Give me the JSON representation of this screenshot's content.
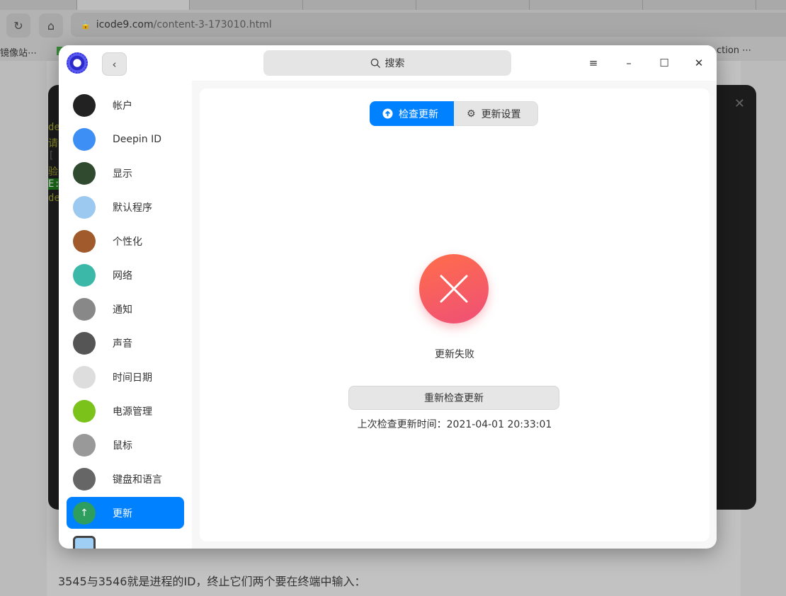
{
  "browser": {
    "url_host": "icode9.com",
    "url_path": "/content-3-173010.html",
    "bookmark_left": "镜像站⋯",
    "bookmark_right": "ction ⋯"
  },
  "article": {
    "text": "3545与3546就是进程的ID，终止它们两个要在终端中输入："
  },
  "terminal": {
    "lines": [
      "de",
      "请",
      "[ S",
      "验",
      "E:",
      "de"
    ]
  },
  "window": {
    "search_placeholder": "搜索",
    "sidebar": [
      {
        "label": "帐户",
        "icon": "account-icon",
        "color": "#222"
      },
      {
        "label": "Deepin ID",
        "icon": "cloud-icon",
        "color": "#3d8ef5"
      },
      {
        "label": "显示",
        "icon": "display-icon",
        "color": "#2f4a2f"
      },
      {
        "label": "默认程序",
        "icon": "default-apps-icon",
        "color": "#9cc9f0"
      },
      {
        "label": "个性化",
        "icon": "palette-icon",
        "color": "#a05a2c"
      },
      {
        "label": "网络",
        "icon": "network-icon",
        "color": "#3cb8a8"
      },
      {
        "label": "通知",
        "icon": "bell-icon",
        "color": "#888"
      },
      {
        "label": "声音",
        "icon": "speaker-icon",
        "color": "#555"
      },
      {
        "label": "时间日期",
        "icon": "clock-icon",
        "color": "#ddd"
      },
      {
        "label": "电源管理",
        "icon": "battery-icon",
        "color": "#7bc21b"
      },
      {
        "label": "鼠标",
        "icon": "mouse-icon",
        "color": "#999"
      },
      {
        "label": "键盘和语言",
        "icon": "keyboard-icon",
        "color": "#666"
      },
      {
        "label": "更新",
        "icon": "update-arrow-icon",
        "color": "#2e9e5e",
        "selected": true
      }
    ],
    "tabs": {
      "check": "检查更新",
      "settings": "更新设置"
    },
    "status": "更新失败",
    "retry": "重新检查更新",
    "last_check": "上次检查更新时间：2021-04-01 20:33:01",
    "accent": "#0081ff"
  }
}
